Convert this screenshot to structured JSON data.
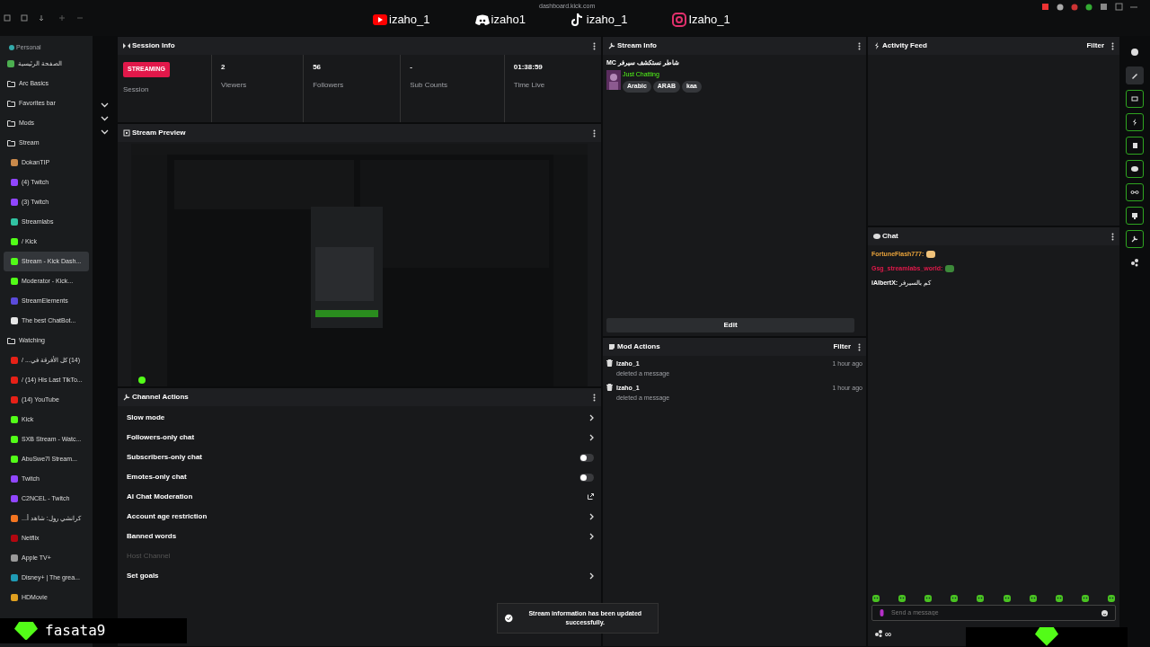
{
  "browser": {
    "url": "dashboard.kick.com",
    "socials": [
      {
        "kind": "youtube",
        "handle": "izaho_1"
      },
      {
        "kind": "discord",
        "handle": "izaho1"
      },
      {
        "kind": "tiktok",
        "handle": "izaho_1"
      },
      {
        "kind": "instagram",
        "handle": "Izaho_1"
      }
    ]
  },
  "sidebar": {
    "space": "Personal",
    "items": [
      {
        "label": "الصفحة الرئيسية",
        "kind": "tab",
        "color": "#4caf50",
        "selected": false
      },
      {
        "label": "Arc Basics",
        "kind": "folder",
        "selected": false
      },
      {
        "label": "Favorites bar",
        "kind": "folder",
        "selected": false
      },
      {
        "label": "Mods",
        "kind": "folder",
        "selected": false
      },
      {
        "label": "Stream",
        "kind": "folder",
        "selected": false,
        "children": [
          {
            "label": "DokanTIP",
            "kind": "tab",
            "color": "#c98a4b",
            "selected": false
          },
          {
            "label": "(4) Twitch",
            "kind": "tab",
            "color": "#9146ff",
            "selected": false
          },
          {
            "label": "(3) Twitch",
            "kind": "tab",
            "color": "#9146ff",
            "selected": false
          },
          {
            "label": "Streamlabs",
            "kind": "tab",
            "color": "#31c3a2",
            "selected": false
          },
          {
            "label": "/ Kick",
            "kind": "tab",
            "color": "#53fc18",
            "selected": false
          },
          {
            "label": "Stream - Kick Dash...",
            "kind": "tab",
            "color": "#53fc18",
            "selected": true
          },
          {
            "label": "Moderator - Kick...",
            "kind": "tab",
            "color": "#53fc18",
            "selected": false
          },
          {
            "label": "StreamElements",
            "kind": "tab",
            "color": "#5b4bdb",
            "selected": false
          },
          {
            "label": "The best ChatBot...",
            "kind": "tab",
            "color": "#e6e6e6",
            "selected": false
          }
        ]
      },
      {
        "label": "Watching",
        "kind": "folder",
        "selected": false,
        "children": [
          {
            "label": "(14) كل الأفرقة في... /",
            "kind": "tab",
            "color": "#e62117",
            "selected": false
          },
          {
            "label": "/ (14) His Last TikTo...",
            "kind": "tab",
            "color": "#e62117",
            "selected": false
          },
          {
            "label": "(14) YouTube",
            "kind": "tab",
            "color": "#e62117",
            "selected": false
          },
          {
            "label": "Kick",
            "kind": "tab",
            "color": "#53fc18",
            "selected": false
          },
          {
            "label": "SXB Stream - Watc...",
            "kind": "tab",
            "color": "#53fc18",
            "selected": false
          },
          {
            "label": "AbuSwe7l Stream...",
            "kind": "tab",
            "color": "#53fc18",
            "selected": false
          },
          {
            "label": "Twitch",
            "kind": "tab",
            "color": "#9146ff",
            "selected": false
          },
          {
            "label": "C2NCEL - Twitch",
            "kind": "tab",
            "color": "#9146ff",
            "selected": false
          },
          {
            "label": "كرانشي رول: شاهد أ...",
            "kind": "tab",
            "color": "#f47521",
            "selected": false
          },
          {
            "label": "Netflix",
            "kind": "tab",
            "color": "#b20710",
            "selected": false
          },
          {
            "label": "Apple TV+",
            "kind": "tab",
            "color": "#9a9a9a",
            "selected": false
          },
          {
            "label": "Disney+ | The grea...",
            "kind": "tab",
            "color": "#1f9bb5",
            "selected": false
          },
          {
            "label": "HDMovie",
            "kind": "tab",
            "color": "#e0a020",
            "selected": false
          }
        ]
      }
    ]
  },
  "session_info": {
    "title": "Session Info",
    "status": "STREAMING",
    "status_label": "Session",
    "stats": [
      {
        "value": "2",
        "label": "Viewers"
      },
      {
        "value": "56",
        "label": "Followers"
      },
      {
        "value": "-",
        "label": "Sub Counts"
      },
      {
        "value": "01:38:59",
        "label": "Time Live"
      }
    ]
  },
  "stream_preview": {
    "title": "Stream Preview"
  },
  "channel_actions": {
    "title": "Channel Actions",
    "items": [
      {
        "label": "Slow mode",
        "kind": "link"
      },
      {
        "label": "Followers-only chat",
        "kind": "link"
      },
      {
        "label": "Subscribers-only chat",
        "kind": "toggle",
        "on": false
      },
      {
        "label": "Emotes-only chat",
        "kind": "toggle",
        "on": false
      },
      {
        "label": "AI Chat Moderation",
        "kind": "external"
      },
      {
        "label": "Account age restriction",
        "kind": "link"
      },
      {
        "label": "Banned words",
        "kind": "link"
      },
      {
        "label": "Host Channel",
        "kind": "disabled"
      },
      {
        "label": "Set goals",
        "kind": "link"
      }
    ]
  },
  "stream_info": {
    "title": "Stream Info",
    "stream_title": "شاطر نستكشف سيرفر MC",
    "category": "Just Chatting",
    "tags": [
      "Arabic",
      "ARAB",
      "kaa"
    ],
    "edit": "Edit"
  },
  "mod_actions": {
    "title": "Mod Actions",
    "filter": "Filter",
    "items": [
      {
        "user": "Izaho_1",
        "action": "deleted a message",
        "time": "1 hour ago"
      },
      {
        "user": "Izaho_1",
        "action": "deleted a message",
        "time": "1 hour ago"
      }
    ]
  },
  "activity_feed": {
    "title": "Activity Feed",
    "filter": "Filter"
  },
  "chat": {
    "title": "Chat",
    "messages": [
      {
        "user": "FortuneFlash777:",
        "color": "#e8a23a"
      },
      {
        "user": "Gsg_streamlabs_world:",
        "color": "#e0194a"
      },
      {
        "user": "iAlbertX:",
        "color": "#ffffff",
        "text": "كم بالسيرفر"
      }
    ],
    "placeholder": "Send a message",
    "balance": "∞"
  },
  "rail": [
    {
      "kind": "info",
      "on": false
    },
    {
      "kind": "pencil",
      "on": true
    },
    {
      "kind": "preview",
      "on": true
    },
    {
      "kind": "bolt",
      "on": true
    },
    {
      "kind": "note",
      "on": true
    },
    {
      "kind": "chat",
      "on": true
    },
    {
      "kind": "link",
      "on": true
    },
    {
      "kind": "monitor",
      "on": true
    },
    {
      "kind": "wrench",
      "on": true
    },
    {
      "kind": "share",
      "on": false
    }
  ],
  "toast": "Stream information has been updated successfully.",
  "overlay": {
    "username": "fasata9"
  }
}
